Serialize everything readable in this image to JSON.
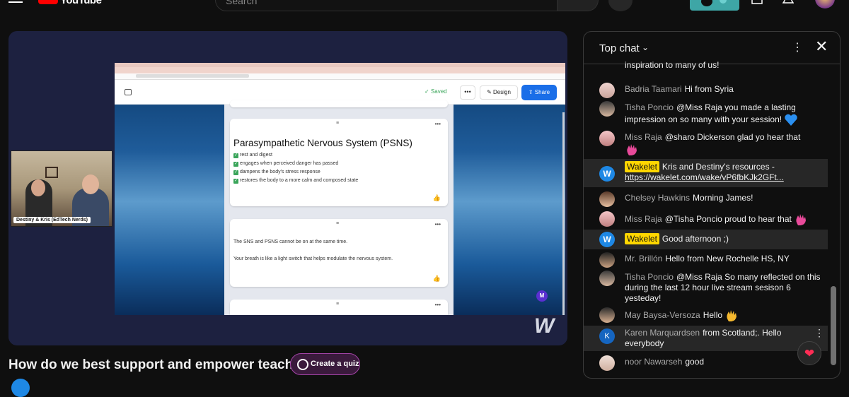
{
  "header": {
    "logo_text": "YouTube",
    "search_placeholder": "Search",
    "icons": [
      "menu-icon",
      "search-icon",
      "mic-icon",
      "create-icon",
      "notifications-icon",
      "avatar"
    ]
  },
  "player": {
    "webcam_label": "Destiny & Kris (EdTech Nerds)",
    "watermark": "W"
  },
  "shared_screen": {
    "status": "Saved",
    "design_label": "Design",
    "share_label": "Share",
    "card1": {
      "title": "Parasympathetic Nervous System (PSNS)",
      "items": [
        "rest and digest",
        "engages when perceived danger has passed",
        "dampens the body's stress response",
        "restores the body to a more calm and composed state"
      ]
    },
    "card2": {
      "line1": "The SNS and PSNS cannot be on at the same time.",
      "line2": "Your breath is like a light switch that helps modulate the nervous system."
    },
    "badge_letter": "M"
  },
  "video": {
    "title": "How do we best support and empower teachers?",
    "quiz_button": "Create a quiz"
  },
  "chat": {
    "header_title": "Top chat",
    "messages": [
      {
        "name": "",
        "text": "inspiration to many of us!"
      },
      {
        "name": "Badria Taamari",
        "text": "Hi from Syria"
      },
      {
        "name": "Tisha Poncio",
        "text": "@Miss Raja you made a lasting impression on so many with your session!"
      },
      {
        "name": "Miss Raja",
        "text": "@sharo Dickerson glad yo hear that"
      },
      {
        "name": "Wakelet",
        "text": "Kris and Destiny's resources - ",
        "link": "https://wakelet.com/wake/vP6fbKJk2GFt..."
      },
      {
        "name": "Chelsey Hawkins",
        "text": "Morning James!"
      },
      {
        "name": "Miss Raja",
        "text": "@Tisha Poncio proud to hear that"
      },
      {
        "name": "Wakelet",
        "text": "Good afternoon ;)"
      },
      {
        "name": "Mr. Brillón",
        "text": "Hello from New Rochelle HS, NY"
      },
      {
        "name": "Tisha Poncio",
        "text": "@Miss Raja So many reflected on this during the last 12 hour live stream sesison 6 yesteday!"
      },
      {
        "name": "May Baysa-Versoza",
        "text": "Hello"
      },
      {
        "name": "Karen Marquardsen",
        "text": "from Scotland;. Hello everybody"
      },
      {
        "name": "noor Nawarseh",
        "text": "good"
      }
    ],
    "karen_initial": "K",
    "react_icon": "heart-icon"
  },
  "colors": {
    "youtube_red": "#ff0000",
    "player_bg": "#1d2140",
    "moderator_badge": "#ffd600",
    "quiz_border": "#a243a6"
  }
}
